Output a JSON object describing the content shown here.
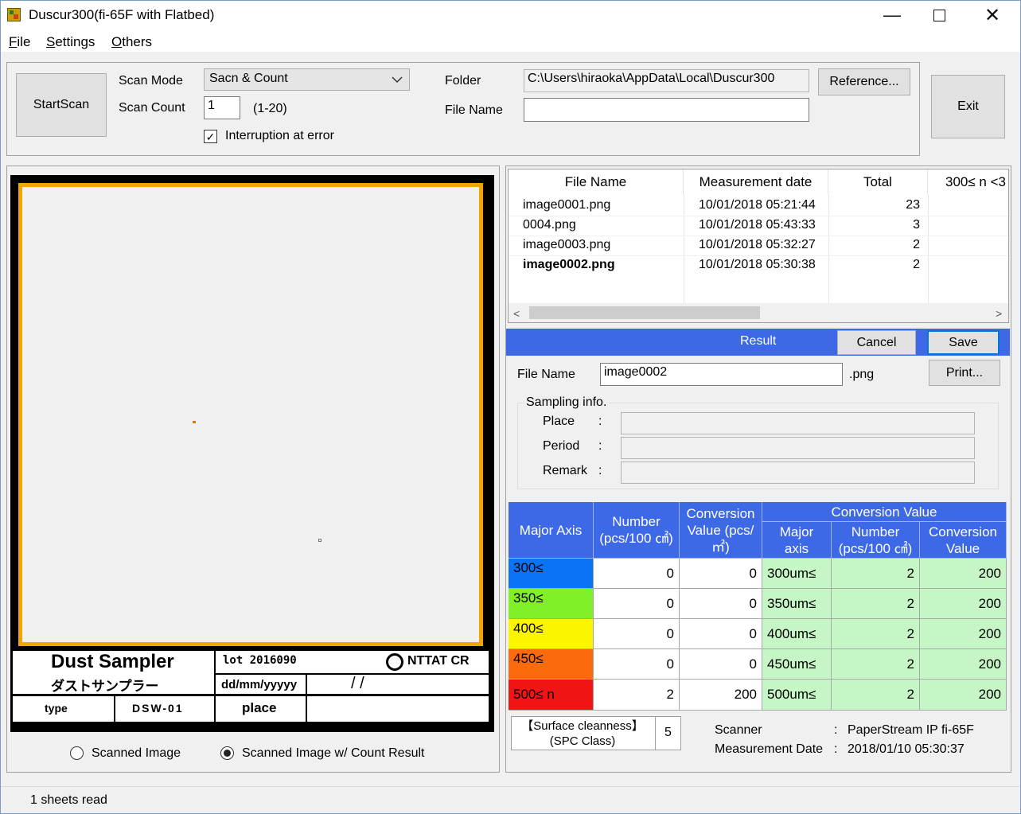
{
  "window": {
    "title": "Duscur300(fi-65F with Flatbed)"
  },
  "menu": {
    "file": "File",
    "settings": "Settings",
    "others": "Others"
  },
  "toolbar": {
    "start_scan": "StartScan",
    "scan_mode_label": "Scan Mode",
    "scan_mode_value": "Sacn & Count",
    "scan_count_label": "Scan Count",
    "scan_count_value": "1",
    "scan_count_range": "(1-20)",
    "interruption_label": "Interruption at error",
    "interruption_checked": true,
    "folder_label": "Folder",
    "folder_value": "C:\\Users\\hiraoka\\AppData\\Local\\Duscur300",
    "reference_button": "Reference...",
    "file_name_label": "File Name",
    "file_name_value": "",
    "exit_button": "Exit"
  },
  "file_list": {
    "columns": [
      "File Name",
      "Measurement date",
      "Total",
      "300≤ n <3"
    ],
    "rows": [
      {
        "file": "image0001.png",
        "date": "10/01/2018 05:21:44",
        "total": "23",
        "bold": false
      },
      {
        "file": "0004.png",
        "date": "10/01/2018 05:43:33",
        "total": "3",
        "bold": false
      },
      {
        "file": "image0003.png",
        "date": "10/01/2018 05:32:27",
        "total": "2",
        "bold": false
      },
      {
        "file": "image0002.png",
        "date": "10/01/2018 05:30:38",
        "total": "2",
        "bold": true
      }
    ]
  },
  "result": {
    "title": "Result",
    "cancel_button": "Cancel",
    "save_button": "Save",
    "file_name_label": "File Name",
    "file_name_value": "image0002",
    "file_ext": ".png",
    "print_button": "Print...",
    "sampling_group": "Sampling info.",
    "place_label": "Place",
    "period_label": "Period",
    "remark_label": "Remark",
    "colon": ":",
    "place_value": "",
    "period_value": "",
    "remark_value": ""
  },
  "result_table": {
    "hdr_major_axis": "Major Axis",
    "hdr_number": "Number (pcs/100 ㎠)",
    "hdr_conversion": "Conversion Value (pcs/ ㎡)",
    "hdr_conv_group": "Conversion Value",
    "hdr_major_axis2": "Major axis",
    "hdr_number2": "Number (pcs/100 ㎠)",
    "hdr_conversion2": "Conversion Value",
    "rows": [
      {
        "axis": "300≤",
        "color": "#0b74f5",
        "number": "0",
        "conv": "0",
        "axis2": "300um≤",
        "number2": "2",
        "conv2": "200"
      },
      {
        "axis": "350≤",
        "color": "#80f028",
        "number": "0",
        "conv": "0",
        "axis2": "350um≤",
        "number2": "2",
        "conv2": "200"
      },
      {
        "axis": "400≤",
        "color": "#fcf500",
        "number": "0",
        "conv": "0",
        "axis2": "400um≤",
        "number2": "2",
        "conv2": "200"
      },
      {
        "axis": "450≤",
        "color": "#fb6a0c",
        "number": "0",
        "conv": "0",
        "axis2": "450um≤",
        "number2": "2",
        "conv2": "200"
      },
      {
        "axis": "500≤ n",
        "color": "#f01414",
        "number": "2",
        "conv": "200",
        "axis2": "500um≤",
        "number2": "2",
        "conv2": "200"
      }
    ]
  },
  "summary": {
    "cleanness_label": "【Surface cleanness】 (SPC Class)",
    "cleanness_value": "5",
    "scanner_label": "Scanner",
    "scanner_value": "PaperStream IP fi-65F",
    "measurement_date_label": "Measurement Date",
    "measurement_date_value": "2018/01/10 05:30:37",
    "colon": ":"
  },
  "scanned_card": {
    "title_en": "Dust Sampler",
    "title_jp": "ダストサンプラー",
    "lot": "lot 2016090",
    "brand": "NTTAT CR",
    "date_format": "dd/mm/yyyyy",
    "date_slashes": "/        /",
    "type_label": "type",
    "type_value": "DSW-01",
    "place_label": "place",
    "frame_color": "#f2a500"
  },
  "view_options": {
    "scanned_image": "Scanned Image",
    "scanned_with_count": "Scanned Image w/ Count Result",
    "selected": "scanned_with_count"
  },
  "status": {
    "text": "1 sheets read"
  }
}
